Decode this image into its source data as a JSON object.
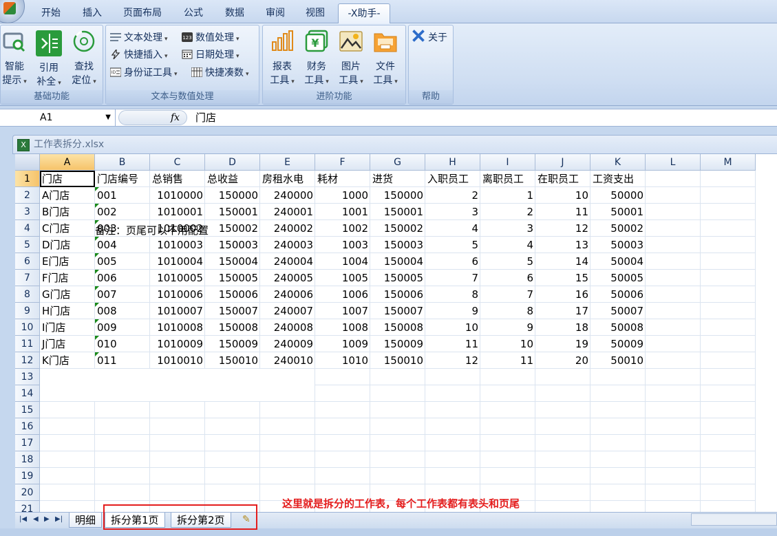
{
  "ribbon_tabs": [
    "开始",
    "插入",
    "页面布局",
    "公式",
    "数据",
    "审阅",
    "视图",
    "-X助手-"
  ],
  "groups": {
    "basic": {
      "title": "基础功能",
      "buttons": [
        [
          "智能",
          "提示"
        ],
        [
          "引用",
          "补全"
        ],
        [
          "查找",
          "定位"
        ]
      ]
    },
    "text": {
      "title": "文本与数值处理",
      "items": [
        "文本处理",
        "数值处理",
        "快捷插入",
        "日期处理",
        "身份证工具",
        "快捷凑数"
      ]
    },
    "advanced": {
      "title": "进阶功能",
      "buttons": [
        [
          "报表",
          "工具"
        ],
        [
          "财务",
          "工具"
        ],
        [
          "图片",
          "工具"
        ],
        [
          "文件",
          "工具"
        ]
      ]
    },
    "help": {
      "title": "帮助",
      "about": "关于"
    }
  },
  "formula_bar": {
    "name_box": "A1",
    "fx": "fx",
    "value": "门店"
  },
  "workbook": {
    "title": "工作表拆分.xlsx"
  },
  "columns": [
    "A",
    "B",
    "C",
    "D",
    "E",
    "F",
    "G",
    "H",
    "I",
    "J",
    "K",
    "L",
    "M"
  ],
  "rows": [
    "1",
    "2",
    "3",
    "4",
    "5",
    "6",
    "7",
    "8",
    "9",
    "10",
    "11",
    "12",
    "13",
    "14",
    "15",
    "16",
    "17",
    "18",
    "19",
    "20",
    "21"
  ],
  "table": {
    "headers": [
      "门店",
      "门店编号",
      "总销售",
      "总收益",
      "房租水电",
      "耗材",
      "进货",
      "入职员工",
      "离职员工",
      "在职员工",
      "工资支出"
    ],
    "rows": [
      [
        "A门店",
        "001",
        "1010000",
        "150000",
        "240000",
        "1000",
        "150000",
        "2",
        "1",
        "10",
        "50000"
      ],
      [
        "B门店",
        "002",
        "1010001",
        "150001",
        "240001",
        "1001",
        "150001",
        "3",
        "2",
        "11",
        "50001"
      ],
      [
        "C门店",
        "003",
        "1010002",
        "150002",
        "240002",
        "1002",
        "150002",
        "4",
        "3",
        "12",
        "50002"
      ],
      [
        "D门店",
        "004",
        "1010003",
        "150003",
        "240003",
        "1003",
        "150003",
        "5",
        "4",
        "13",
        "50003"
      ],
      [
        "E门店",
        "005",
        "1010004",
        "150004",
        "240004",
        "1004",
        "150004",
        "6",
        "5",
        "14",
        "50004"
      ],
      [
        "F门店",
        "006",
        "1010005",
        "150005",
        "240005",
        "1005",
        "150005",
        "7",
        "6",
        "15",
        "50005"
      ],
      [
        "G门店",
        "007",
        "1010006",
        "150006",
        "240006",
        "1006",
        "150006",
        "8",
        "7",
        "16",
        "50006"
      ],
      [
        "H门店",
        "008",
        "1010007",
        "150007",
        "240007",
        "1007",
        "150007",
        "9",
        "8",
        "17",
        "50007"
      ],
      [
        "I门店",
        "009",
        "1010008",
        "150008",
        "240008",
        "1008",
        "150008",
        "10",
        "9",
        "18",
        "50008"
      ],
      [
        "J门店",
        "010",
        "1010009",
        "150009",
        "240009",
        "1009",
        "150009",
        "11",
        "10",
        "19",
        "50009"
      ],
      [
        "K门店",
        "011",
        "1010010",
        "150010",
        "240010",
        "1010",
        "150010",
        "12",
        "11",
        "20",
        "50010"
      ]
    ]
  },
  "note": "备注：页尾可以不用配置",
  "sheets": [
    "明细",
    "拆分第1页",
    "拆分第2页"
  ],
  "annotation": "这里就是拆分的工作表，每个工作表都有表头和页尾",
  "colors": {
    "accent_red": "#e41d1d",
    "header_selected": "#f6c36a",
    "green_button": "#2a9b3c"
  }
}
